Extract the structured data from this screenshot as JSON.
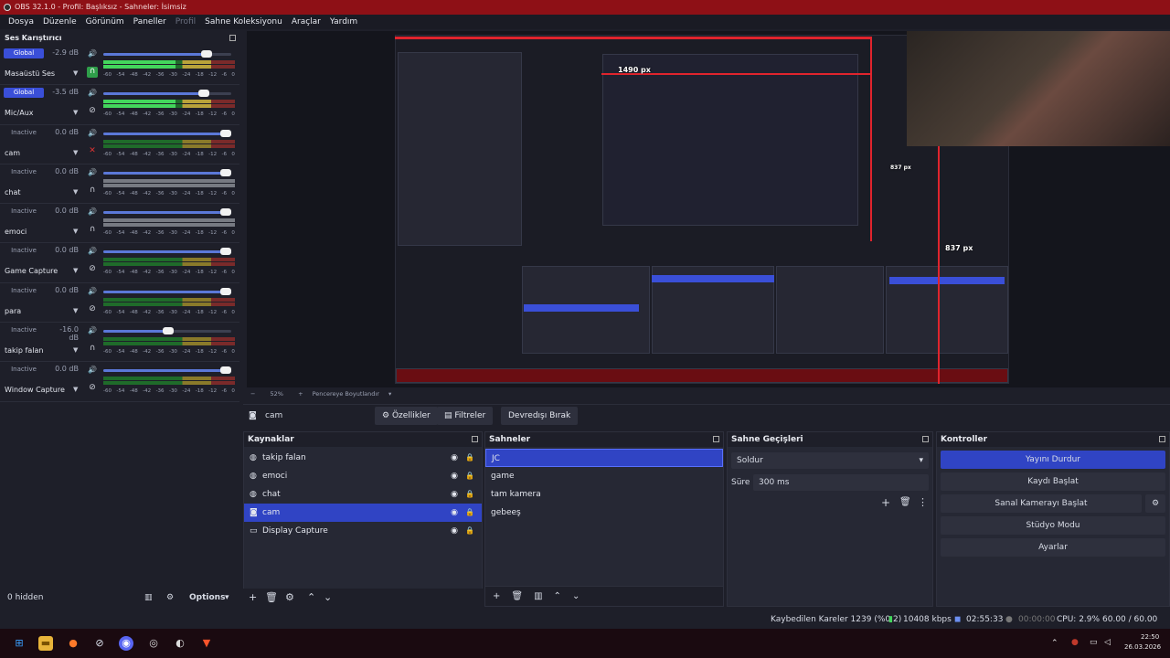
{
  "window": {
    "title": "OBS 32.1.0 - Profil: Başlıksız - Sahneler: İsimsiz"
  },
  "menu": [
    "Dosya",
    "Düzenle",
    "Görünüm",
    "Paneller",
    "Profil",
    "Sahne Koleksiyonu",
    "Araçlar",
    "Yardım"
  ],
  "mixer": {
    "title": "Ses Karıştırıcı",
    "scale": [
      "-60",
      "-54",
      "-48",
      "-42",
      "-36",
      "-30",
      "-24",
      "-18",
      "-12",
      "-6",
      "0"
    ],
    "channels": [
      {
        "name": "Masaüstü Ses",
        "tag": "Global",
        "db": "-2.9 dB",
        "level": 0.85,
        "active": true,
        "monitor": "headphones-on"
      },
      {
        "name": "Mic/Aux",
        "tag": "Global",
        "db": "-3.5 dB",
        "level": 0.83,
        "active": true,
        "monitor": "monitor-off"
      },
      {
        "name": "cam",
        "tag": "Inactive",
        "db": "0.0 dB",
        "level": 1.0,
        "active": false,
        "monitor": "muted-red"
      },
      {
        "name": "chat",
        "tag": "Inactive",
        "db": "0.0 dB",
        "level": 1.0,
        "active": false,
        "monitor": "headphones"
      },
      {
        "name": "emoci",
        "tag": "Inactive",
        "db": "0.0 dB",
        "level": 1.0,
        "active": false,
        "monitor": "headphones"
      },
      {
        "name": "Game Capture",
        "tag": "Inactive",
        "db": "0.0 dB",
        "level": 1.0,
        "active": false,
        "monitor": "monitor-off"
      },
      {
        "name": "para",
        "tag": "Inactive",
        "db": "0.0 dB",
        "level": 1.0,
        "active": false,
        "monitor": "monitor-off"
      },
      {
        "name": "takip falan",
        "tag": "Inactive",
        "db": "-16.0 dB",
        "level": 0.55,
        "active": false,
        "monitor": "headphones"
      },
      {
        "name": "Window Capture",
        "tag": "Inactive",
        "db": "0.0 dB",
        "level": 1.0,
        "active": false,
        "monitor": "monitor-off"
      }
    ]
  },
  "preview": {
    "label_1490": "1490 px",
    "label_837": "837 px",
    "label_837b": "837 px",
    "zoom": "52%",
    "resize": "Pencereye Boyutlandır"
  },
  "source_bar": {
    "name": "cam",
    "props": "Özellikler",
    "filters": "Filtreler",
    "disable": "Devredışı Bırak"
  },
  "sources": {
    "title": "Kaynaklar",
    "items": [
      {
        "name": "takip falan",
        "icon": "browser-icon",
        "selected": false
      },
      {
        "name": "emoci",
        "icon": "browser-icon",
        "selected": false
      },
      {
        "name": "chat",
        "icon": "browser-icon",
        "selected": false
      },
      {
        "name": "cam",
        "icon": "camera-icon",
        "selected": true
      },
      {
        "name": "Display Capture",
        "icon": "display-icon",
        "selected": false
      }
    ],
    "hidden": "0 hidden",
    "options": "Options"
  },
  "scenes": {
    "title": "Sahneler",
    "items": [
      "JC",
      "game",
      "tam kamera",
      "gebeeş"
    ],
    "selected": 0
  },
  "transitions": {
    "title": "Sahne Geçişleri",
    "type": "Soldur",
    "duration_label": "Süre",
    "duration": "300 ms"
  },
  "controls": {
    "title": "Kontroller",
    "stop_stream": "Yayını Durdur",
    "start_record": "Kaydı Başlat",
    "virtual_cam": "Sanal Kamerayı Başlat",
    "studio": "Stüdyo Modu",
    "settings": "Ayarlar"
  },
  "status": {
    "dropped": "Kaybedilen Kareler 1239 (%0.2)",
    "bitrate": "10408 kbps",
    "stream_time": "02:55:33",
    "rec_time": "00:00:00",
    "cpu": "CPU: 2.9%",
    "fps": "60.00 / 60.00 FPS"
  },
  "taskbar": {
    "time": "22:50",
    "date": "26.03.2026"
  },
  "colors": {
    "accent": "#3044c4",
    "titlebar": "#8e1016",
    "meter_green": "#43d65c"
  }
}
